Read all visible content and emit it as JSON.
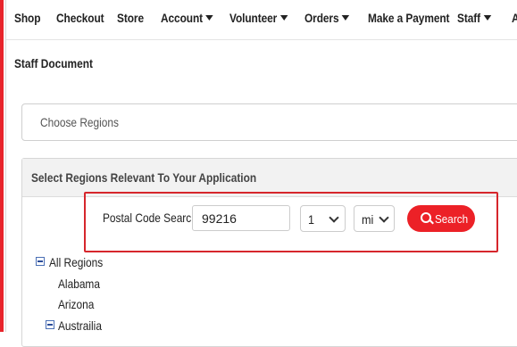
{
  "nav": {
    "items": [
      {
        "label": "Shop"
      },
      {
        "label": "Checkout"
      },
      {
        "label": "Store"
      },
      {
        "label": "Account",
        "dropdown": true
      },
      {
        "label": "Volunteer",
        "dropdown": true
      },
      {
        "label": "Orders",
        "dropdown": true
      },
      {
        "label": "Make a Payment"
      },
      {
        "label": "Staff",
        "dropdown": true
      },
      {
        "label": "A"
      }
    ]
  },
  "page": {
    "title": "Staff Document"
  },
  "choose_regions": {
    "placeholder": "Choose Regions"
  },
  "panel": {
    "title": "Select Regions Relevant To Your Application"
  },
  "postal_search": {
    "label": "Postal Code Search",
    "postal_code": "99216",
    "distance": "1",
    "unit": "mi",
    "button_label": "Search"
  },
  "tree": {
    "root": "All Regions",
    "items": [
      "Alabama",
      "Arizona"
    ],
    "group": "Austrailia"
  },
  "colors": {
    "accent": "#ec2127",
    "highlight_border": "#d6262c"
  }
}
